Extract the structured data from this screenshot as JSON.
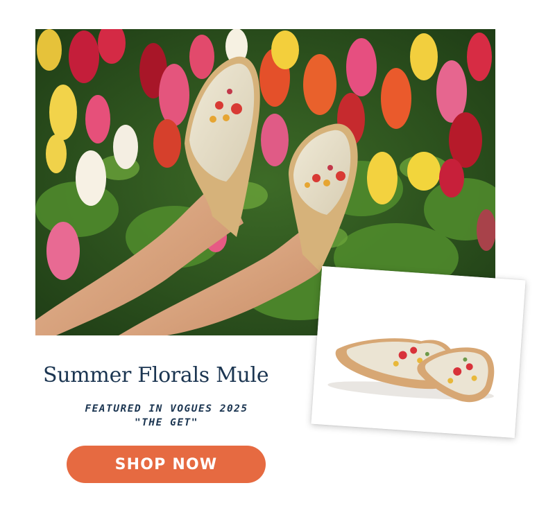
{
  "hero": {
    "description_icon": "photo-legs-in-floral-mules"
  },
  "product": {
    "title": "Summer Florals Mule",
    "featured_line1": "FEATURED IN VOGUES 2025",
    "featured_line2": "\"THE GET\"",
    "cta_label": "SHOP NOW"
  },
  "colors": {
    "title": "#1b3551",
    "cta_background": "#e66a41",
    "cta_text": "#ffffff",
    "page_background": "#ffffff"
  }
}
